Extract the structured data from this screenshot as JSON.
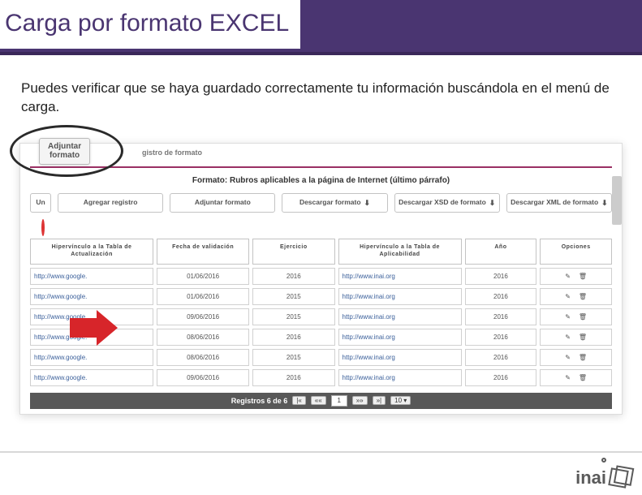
{
  "slide": {
    "title": "Carga por formato EXCEL",
    "instruction": "Puedes verificar que se haya guardado correctamente tu información buscándola en el menú de carga."
  },
  "callout_tab": {
    "line1": "Adjuntar",
    "line2": "formato"
  },
  "breadcrumb_fragment": "gistro de formato",
  "panel_title": "Formato: Rubros aplicables a la página de Internet (último párrafo)",
  "toolbar": {
    "unir": "Un",
    "agregar": "Agregar\nregistro",
    "adjuntar": "Adjuntar\nformato",
    "descargar": "Descargar\nformato",
    "descargar_xsd": "Descargar XSD de\nformato",
    "descargar_xml": "Descargar XML de\nformato"
  },
  "columns": {
    "c1": "Hipervínculo a\nla Tabla de\nActualización",
    "c2": "Fecha de\nvalidación",
    "c3": "Ejercicio",
    "c4": "Hipervínculo a\nla Tabla de\nAplicabilidad",
    "c5": "Año",
    "c6": "Opciones"
  },
  "rows": [
    {
      "link1": "http://www.google.",
      "fecha": "01/06/2016",
      "ejercicio": "2016",
      "link2": "http://www.inai.org",
      "anio": "2016"
    },
    {
      "link1": "http://www.google.",
      "fecha": "01/06/2016",
      "ejercicio": "2015",
      "link2": "http://www.inai.org",
      "anio": "2016"
    },
    {
      "link1": "http://www.google.",
      "fecha": "09/06/2016",
      "ejercicio": "2015",
      "link2": "http://www.inai.org",
      "anio": "2016"
    },
    {
      "link1": "http://www.google.",
      "fecha": "08/06/2016",
      "ejercicio": "2016",
      "link2": "http://www.inai.org",
      "anio": "2016"
    },
    {
      "link1": "http://www.google.",
      "fecha": "08/06/2016",
      "ejercicio": "2015",
      "link2": "http://www.inai.org",
      "anio": "2016"
    },
    {
      "link1": "http://www.google.",
      "fecha": "09/06/2016",
      "ejercicio": "2016",
      "link2": "http://www.inai.org",
      "anio": "2016"
    }
  ],
  "pager": {
    "label": "Registros 6 de 6",
    "first": "|«",
    "prev": "««",
    "page": "1",
    "next": "»»",
    "last": "»|",
    "size": "10 ▾"
  },
  "logo_text": "inai"
}
